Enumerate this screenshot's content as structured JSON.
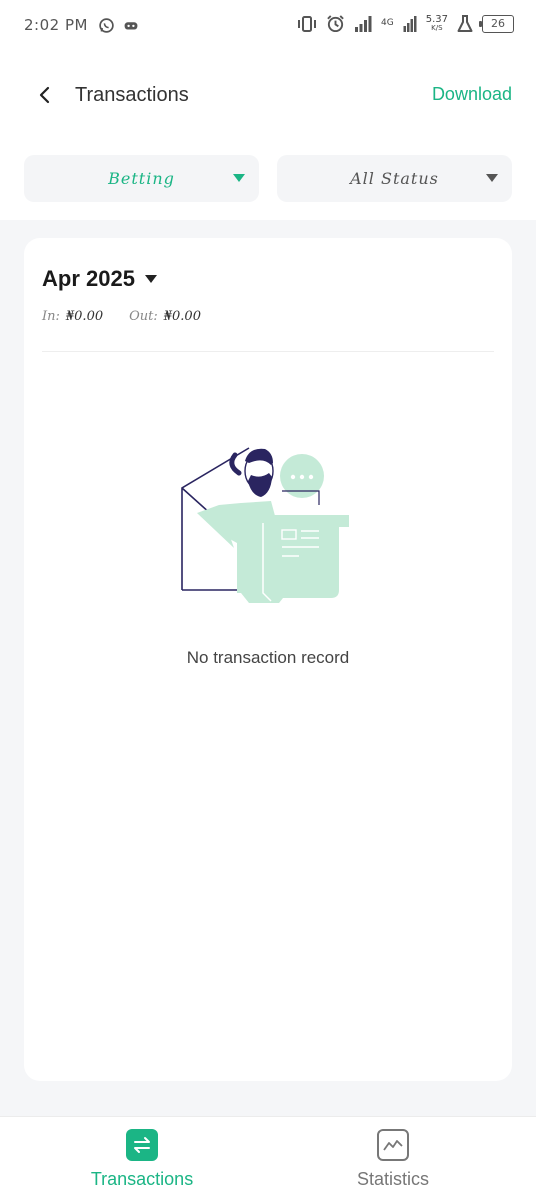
{
  "status_bar": {
    "time": "2:02 PM",
    "network_type": "4G",
    "speed_value": "5.37",
    "speed_unit": "K/S",
    "battery": "26",
    "left_icons": [
      "whatsapp-icon",
      "game-controller-icon"
    ],
    "right_icons": [
      "vibrate-icon",
      "alarm-icon",
      "signal-icon",
      "signal-icon",
      "lab-flask-icon",
      "battery-icon"
    ]
  },
  "header": {
    "title": "Transactions",
    "download_label": "Download"
  },
  "filters": {
    "category": "Betting",
    "status": "All Status"
  },
  "summary": {
    "month": "Apr 2025",
    "in_label": "In:",
    "in_value": "₦0.00",
    "out_label": "Out:",
    "out_value": "₦0.00"
  },
  "empty_state": {
    "message": "No transaction record"
  },
  "bottom_nav": {
    "items": [
      {
        "label": "Transactions",
        "icon": "swap-arrows-icon",
        "active": true
      },
      {
        "label": "Statistics",
        "icon": "line-chart-icon",
        "active": false
      }
    ]
  },
  "colors": {
    "accent": "#1bb585",
    "illustration_fill": "#c4ead7",
    "illustration_ink": "#2a2560",
    "background": "#f5f6f8"
  }
}
